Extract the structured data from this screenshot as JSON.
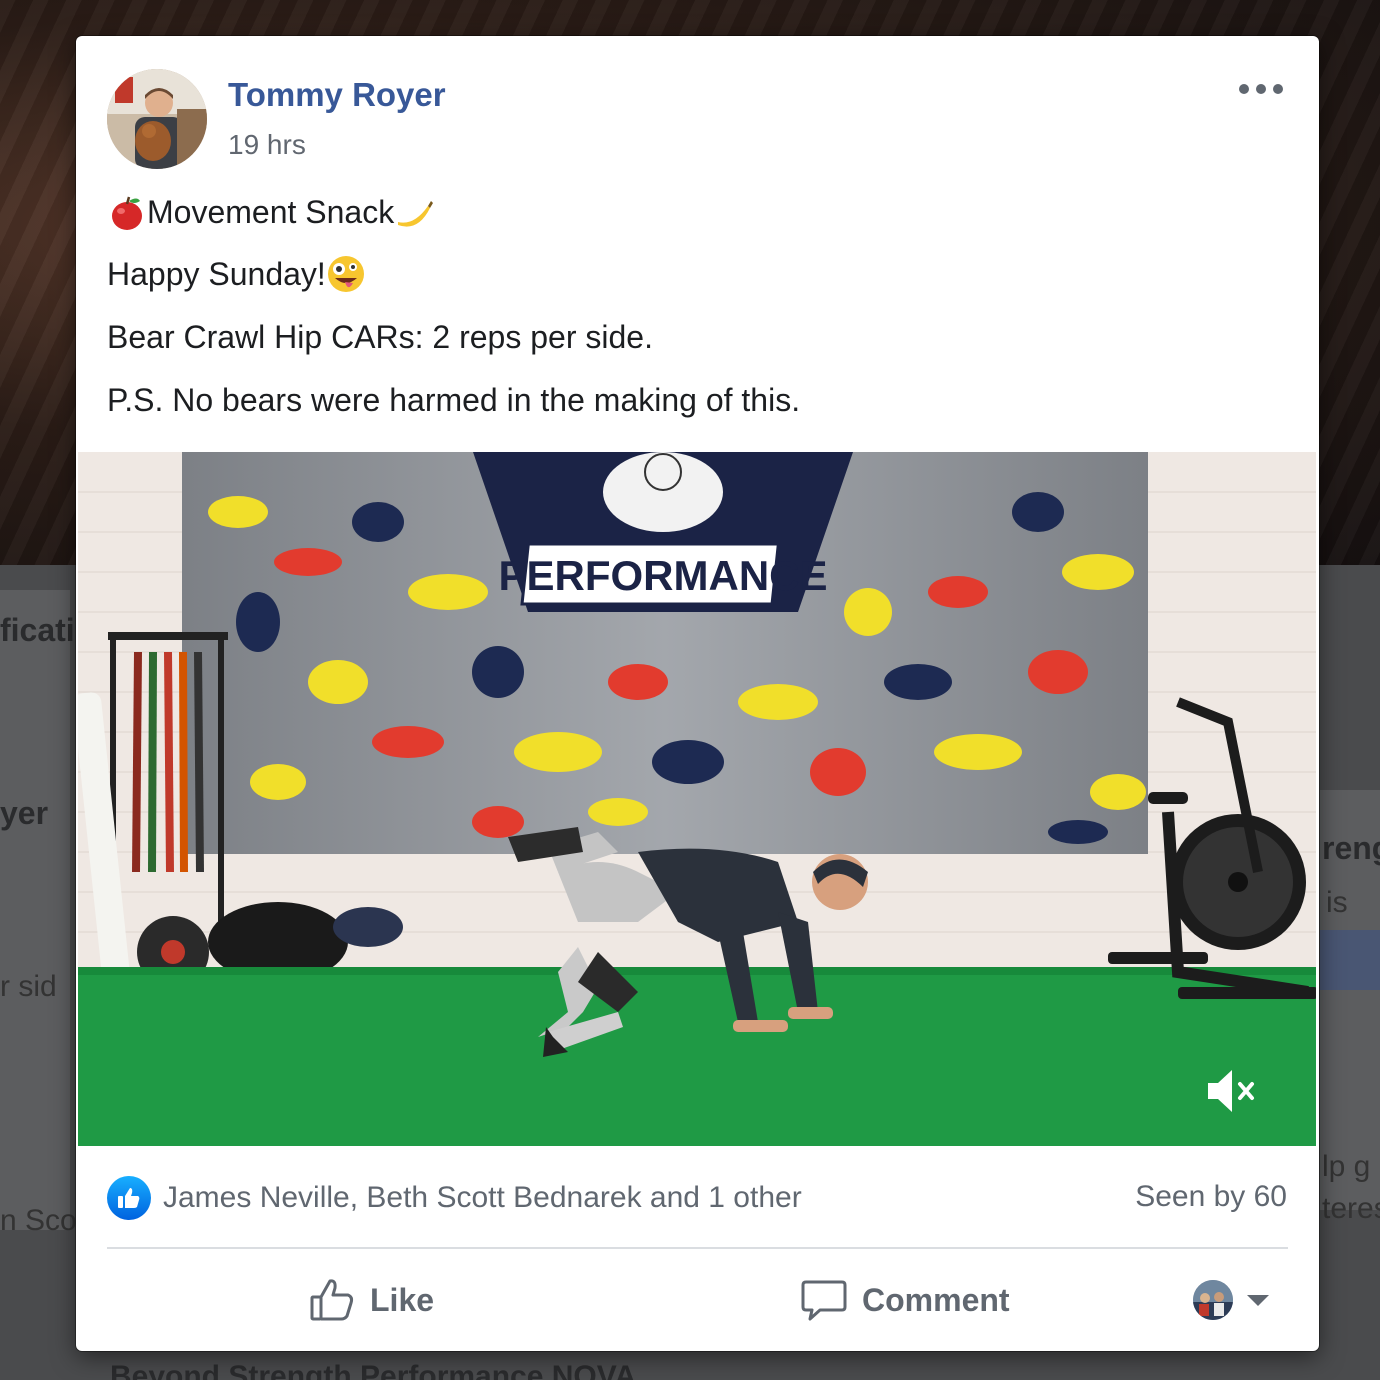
{
  "background_page": {
    "fragments": [
      "ficatio",
      "yer",
      "r sid",
      "n Scot",
      "reng",
      "is",
      "lp g",
      "teres"
    ],
    "bottom_title": "Beyond Strength Performance NOVA"
  },
  "post": {
    "author": "Tommy Royer",
    "timestamp": "19 hrs",
    "lines": [
      {
        "text": "Movement Snack",
        "emoji_before": "red-apple",
        "emoji_after": "banana"
      },
      {
        "text": "Happy Sunday!",
        "emoji_after": "zany-face"
      },
      {
        "text": "Bear Crawl Hip CARs: 2 reps per side."
      },
      {
        "text": "P.S. No bears were harmed in the making of this."
      }
    ],
    "video": {
      "wall_sign": "PERFORMANCE",
      "muted": true
    },
    "reactions": {
      "names": "James Neville, Beth Scott Bednarek and 1 other",
      "seen_by": "Seen by 60"
    },
    "actions": {
      "like": "Like",
      "comment": "Comment"
    }
  },
  "colors": {
    "author_link": "#385898",
    "secondary_text": "#606770",
    "like_blue": "#1877f2",
    "turf_green": "#1f9a45"
  }
}
